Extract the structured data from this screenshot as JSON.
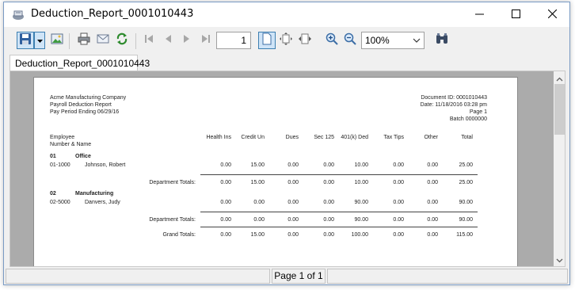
{
  "window": {
    "title": "Deduction_Report_0001010443"
  },
  "toolbar": {
    "page_number": "1",
    "zoom": "100%",
    "icons": [
      "save-icon",
      "dropdown-arrow-icon",
      "image-export-icon",
      "print-icon",
      "email-icon",
      "refresh-icon",
      "first-page-icon",
      "previous-page-icon",
      "next-page-icon",
      "last-page-icon",
      "single-page-icon",
      "fit-page-icon",
      "page-width-icon",
      "zoom-in-icon",
      "zoom-out-icon",
      "binoculars-icon"
    ]
  },
  "tab": {
    "label": "Deduction_Report_0001010443"
  },
  "report": {
    "company": "Acme Manufacturing Company",
    "report_title": "Payroll Deduction Report",
    "period": "Pay Period Ending 06/29/16",
    "document_id": "Document ID: 0001010443",
    "date": "Date: 11/18/2016  03:28 pm",
    "page": "Page 1",
    "batch": "Batch 0000000",
    "col_employee": "Employee",
    "col_number_name": "Number & Name",
    "columns": [
      "Health Ins",
      "Credit Un",
      "Dues",
      "Sec 125",
      "401(k) Ded",
      "Tax Tips",
      "Other",
      "Total"
    ],
    "departments": [
      {
        "code": "01",
        "name": "Office",
        "employee_number": "01-1000",
        "employee_name": "Johnson, Robert",
        "employee_values": [
          "0.00",
          "15.00",
          "0.00",
          "0.00",
          "10.00",
          "0.00",
          "0.00",
          "25.00"
        ],
        "totals_label": "Department Totals:",
        "totals": [
          "0.00",
          "15.00",
          "0.00",
          "0.00",
          "10.00",
          "0.00",
          "0.00",
          "25.00"
        ]
      },
      {
        "code": "02",
        "name": "Manufacturing",
        "employee_number": "02-5000",
        "employee_name": "Danvers, Judy",
        "employee_values": [
          "0.00",
          "0.00",
          "0.00",
          "0.00",
          "90.00",
          "0.00",
          "0.00",
          "90.00"
        ],
        "totals_label": "Department Totals:",
        "totals": [
          "0.00",
          "0.00",
          "0.00",
          "0.00",
          "90.00",
          "0.00",
          "0.00",
          "90.00"
        ]
      }
    ],
    "grand_totals_label": "Grand Totals:",
    "grand_totals": [
      "0.00",
      "15.00",
      "0.00",
      "0.00",
      "100.00",
      "0.00",
      "0.00",
      "115.00"
    ]
  },
  "status": {
    "page_label": "Page 1 of 1"
  },
  "colors": {
    "accent": "#3c7fb1",
    "workspace": "#ababab"
  }
}
